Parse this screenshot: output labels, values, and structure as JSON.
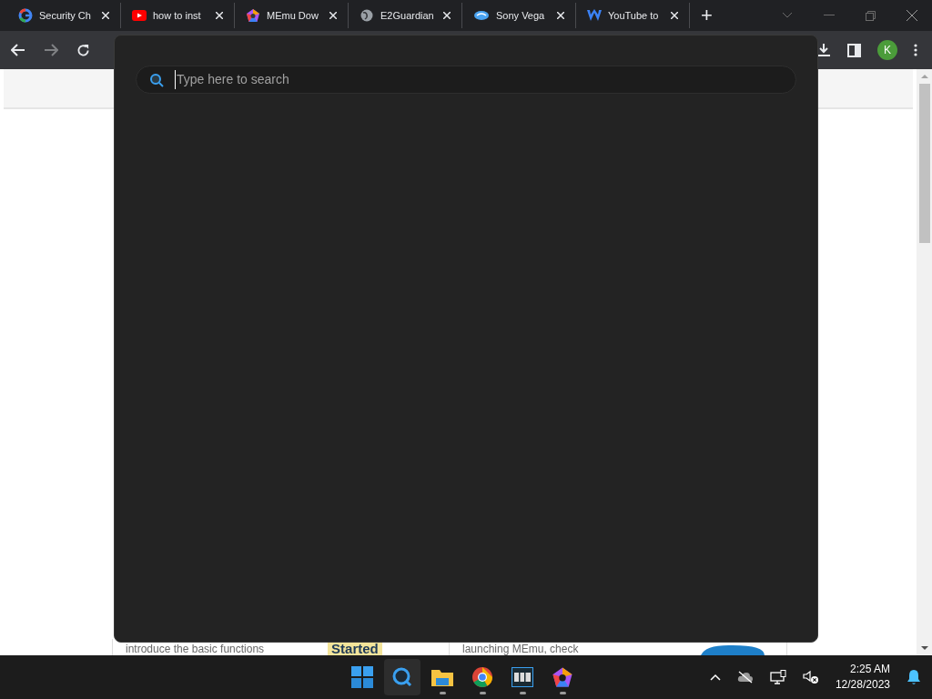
{
  "browser": {
    "tabs": [
      {
        "title": "Security Ch"
      },
      {
        "title": "how to inst"
      },
      {
        "title": "MEmu Dow"
      },
      {
        "title": "E2Guardian"
      },
      {
        "title": "Sony Vega"
      },
      {
        "title": "YouTube to"
      }
    ],
    "new_tab": "+",
    "profile": "K"
  },
  "page": {
    "cards": [
      {
        "text": "introduce the basic functions",
        "badge": "Started",
        "kind": "label"
      },
      {
        "text": "launching MEmu, check",
        "kind": "logo"
      }
    ]
  },
  "search_panel": {
    "placeholder": "Type here to search"
  },
  "taskbar": {
    "apps": [
      {
        "running": false,
        "selected": false
      },
      {
        "running": false,
        "selected": true
      },
      {
        "running": true,
        "selected": false
      },
      {
        "running": true,
        "selected": false
      },
      {
        "running": true,
        "selected": false
      },
      {
        "running": true,
        "selected": false
      }
    ],
    "time": "2:25 AM",
    "date": "12/28/2023"
  }
}
